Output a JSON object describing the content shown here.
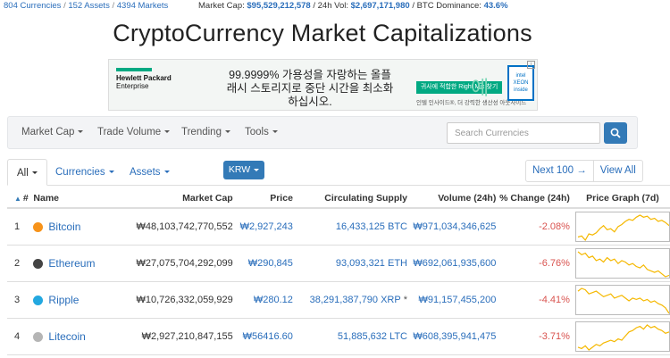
{
  "topbar": {
    "currencies": "804 Currencies",
    "assets": "152 Assets",
    "markets": "4394 Markets",
    "sep": "/",
    "market_cap_label": "Market Cap:",
    "market_cap_value": "$95,529,212,578",
    "vol_label": "/ 24h Vol:",
    "vol_value": "$2,697,171,980",
    "dominance_label": "/ BTC Dominance:",
    "dominance_value": "43.6%"
  },
  "page_title": "CryptoCurrency Market Capitalizations",
  "ad": {
    "brand_line1": "Hewlett Packard",
    "brand_line2": "Enterprise",
    "message": "99.9999% 가용성을 자랑하는 올플래시 스토리지로 중단 시간을 최소화하십시오.",
    "yes_glyph": "예",
    "cta": "귀사에 적합한 Right Mix 찾기",
    "sub": "인텔 인사이드®, 더 강력한 생산성 아웃사이드",
    "chip_text": "intel XEON inside",
    "info": "i",
    "brand_color": "#01a982"
  },
  "navbar": {
    "items": [
      {
        "label": "Market Cap"
      },
      {
        "label": "Trade Volume"
      },
      {
        "label": "Trending"
      },
      {
        "label": "Tools"
      }
    ],
    "search_placeholder": "Search Currencies"
  },
  "tabs": {
    "all": "All",
    "currencies": "Currencies",
    "assets": "Assets",
    "currency_select": "KRW",
    "next": "Next 100 →",
    "view_all": "View All"
  },
  "table": {
    "headers": {
      "rank": "#",
      "name": "Name",
      "market_cap": "Market Cap",
      "price": "Price",
      "supply": "Circulating Supply",
      "volume": "Volume (24h)",
      "change": "% Change (24h)",
      "graph": "Price Graph (7d)"
    },
    "rows": [
      {
        "rank": "1",
        "name": "Bitcoin",
        "icon": "bitcoin-icon",
        "icon_color": "#f7931a",
        "market_cap": "₩48,103,742,770,552",
        "price": "₩2,927,243",
        "supply": "16,433,125 BTC",
        "supply_note": "",
        "volume": "₩971,034,346,625",
        "change": "-2.08%",
        "spark": [
          52,
          50,
          58,
          46,
          48,
          44,
          36,
          30,
          38,
          36,
          42,
          32,
          28,
          22,
          18,
          20,
          14,
          10,
          14,
          12,
          18,
          16,
          22,
          20,
          24,
          30
        ]
      },
      {
        "rank": "2",
        "name": "Ethereum",
        "icon": "ethereum-icon",
        "icon_color": "#444444",
        "market_cap": "₩27,075,704,292,099",
        "price": "₩290,845",
        "supply": "93,093,321 ETH",
        "supply_note": "",
        "volume": "₩692,061,935,600",
        "change": "-6.76%",
        "spark": [
          10,
          14,
          12,
          18,
          16,
          22,
          20,
          24,
          18,
          22,
          20,
          26,
          22,
          24,
          28,
          26,
          30,
          32,
          28,
          34,
          36,
          38,
          36,
          40,
          44,
          42
        ]
      },
      {
        "rank": "3",
        "name": "Ripple",
        "icon": "ripple-icon",
        "icon_color": "#23a8e0",
        "market_cap": "₩10,726,332,059,929",
        "price": "₩280.12",
        "supply": "38,291,387,790 XRP",
        "supply_note": "*",
        "volume": "₩91,157,455,200",
        "change": "-4.41%",
        "spark": [
          16,
          12,
          14,
          20,
          18,
          16,
          20,
          24,
          22,
          20,
          26,
          24,
          22,
          26,
          30,
          26,
          28,
          26,
          30,
          28,
          32,
          30,
          34,
          36,
          40,
          48
        ]
      },
      {
        "rank": "4",
        "name": "Litecoin",
        "icon": "litecoin-icon",
        "icon_color": "#b5b5b5",
        "market_cap": "₩2,927,210,847,155",
        "price": "₩56416.60",
        "supply": "51,885,632 LTC",
        "supply_note": "",
        "volume": "₩608,395,941,475",
        "change": "-3.71%",
        "spark": [
          46,
          48,
          44,
          50,
          46,
          42,
          44,
          40,
          38,
          36,
          38,
          34,
          36,
          30,
          24,
          22,
          18,
          16,
          20,
          14,
          18,
          16,
          20,
          22,
          26,
          24
        ]
      }
    ],
    "spark_color": "#f5b800"
  }
}
